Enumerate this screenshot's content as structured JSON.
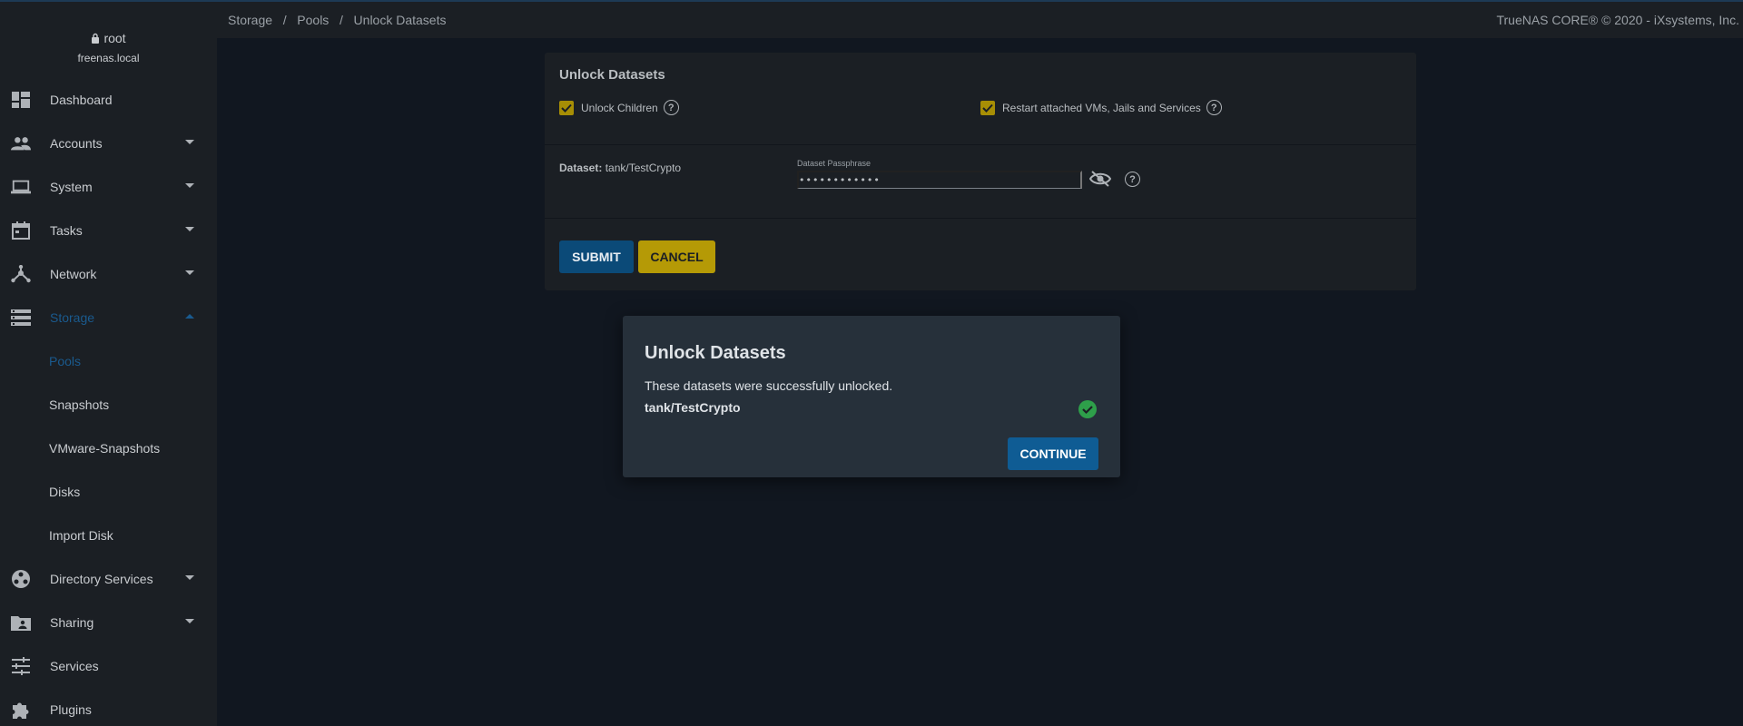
{
  "user": {
    "name": "root",
    "host": "freenas.local"
  },
  "nav": {
    "items": [
      {
        "label": "Dashboard",
        "icon": "dashboard-icon"
      },
      {
        "label": "Accounts",
        "icon": "people-icon"
      },
      {
        "label": "System",
        "icon": "laptop-icon"
      },
      {
        "label": "Tasks",
        "icon": "calendar-icon"
      },
      {
        "label": "Network",
        "icon": "network-icon"
      },
      {
        "label": "Storage",
        "icon": "storage-icon"
      },
      {
        "label": "Directory Services",
        "icon": "directory-icon"
      },
      {
        "label": "Sharing",
        "icon": "folder-share-icon"
      },
      {
        "label": "Services",
        "icon": "tune-icon"
      },
      {
        "label": "Plugins",
        "icon": "puzzle-icon"
      }
    ],
    "storage_sub": [
      "Pools",
      "Snapshots",
      "VMware-Snapshots",
      "Disks",
      "Import Disk"
    ]
  },
  "breadcrumb": [
    "Storage",
    "Pools",
    "Unlock Datasets"
  ],
  "copyright": "TrueNAS CORE® © 2020 - iXsystems, Inc.",
  "form": {
    "title": "Unlock Datasets",
    "unlock_children": "Unlock Children",
    "restart_services": "Restart attached VMs, Jails and Services",
    "dataset_label": "Dataset:",
    "dataset_value": "tank/TestCrypto",
    "passphrase_label": "Dataset Passphrase",
    "passphrase_value": "••••••••••••",
    "submit": "SUBMIT",
    "cancel": "CANCEL"
  },
  "dialog": {
    "title": "Unlock Datasets",
    "message": "These datasets were successfully unlocked.",
    "dataset": "tank/TestCrypto",
    "continue": "CONTINUE"
  },
  "colors": {
    "accent": "#0f5c94",
    "checkbox": "#a78e05",
    "success": "#2e9f4a"
  }
}
